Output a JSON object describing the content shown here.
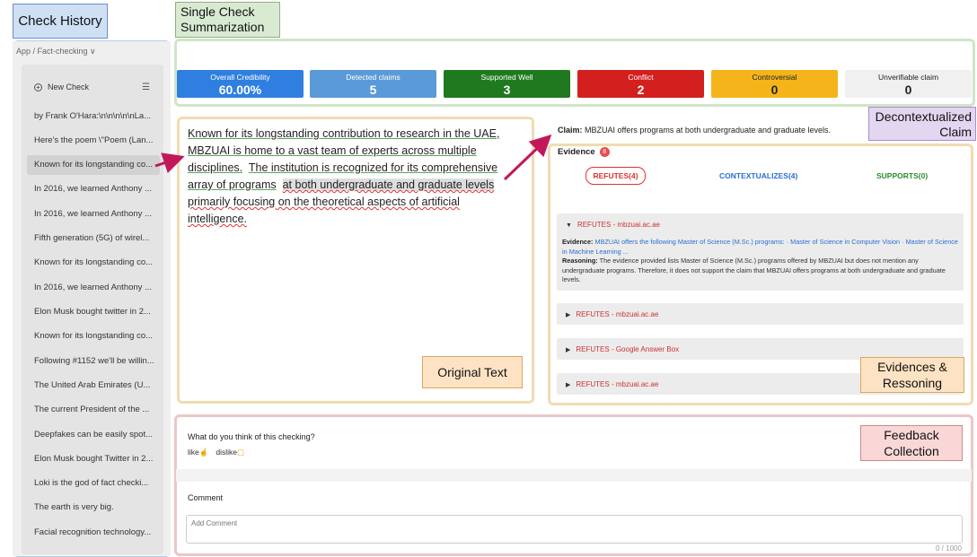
{
  "annotations": {
    "check_history": "Check History",
    "single_check": "Single Check\nSummarization",
    "decontextualized": "Decontextualized\nClaim",
    "original_text": "Original Text",
    "evidences": "Evidences &\nRessoning",
    "feedback": "Feedback\nCollection"
  },
  "breadcrumb": "App / Fact-checking ∨",
  "sidebar": {
    "new_check_label": "New Check",
    "items": [
      "by Frank O'Hara:\\n\\n\\n\\n\\nLa...",
      "Here's the poem \\\"Poem (Lan...",
      "Known for its longstanding co...",
      "In 2016, we learned Anthony ...",
      "In 2016, we learned Anthony ...",
      "Fifth generation (5G) of wirel...",
      "Known for its longstanding co...",
      "In 2016, we learned Anthony ...",
      "Elon Musk bought twitter in 2...",
      "Known for its longstanding co...",
      "Following #1152 we'll be willin...",
      "The United Arab Emirates (U...",
      "The current President of the ...",
      "Deepfakes can be easily spot...",
      "Elon Musk bought Twitter in 2...",
      "Loki is the god of fact checki...",
      "The earth is very big.",
      "Facial recognition technology..."
    ]
  },
  "stats": [
    {
      "label": "Overall Credibility",
      "value": "60.00%",
      "bg": "#2f7fe0",
      "fg": "#ffffff"
    },
    {
      "label": "Detected claims",
      "value": "5",
      "bg": "#5b9ad8",
      "fg": "#ffffff"
    },
    {
      "label": "Supported Well",
      "value": "3",
      "bg": "#1f7a1f",
      "fg": "#ffffff"
    },
    {
      "label": "Conflict",
      "value": "2",
      "bg": "#d41f1f",
      "fg": "#ffffff"
    },
    {
      "label": "Controversial",
      "value": "0",
      "bg": "#f5b51a",
      "fg": "#222222"
    },
    {
      "label": "Unverifiable claim",
      "value": "0",
      "bg": "#f0f0f0",
      "fg": "#222222"
    }
  ],
  "original_text": {
    "s1": "Known for its longstanding contribution to research in the UAE,",
    "s2": "MBZUAI is home to a vast team of experts across multiple disciplines.",
    "s3": "The institution is recognized for its comprehensive array of programs",
    "s4": "at both undergraduate and graduate levels",
    "s5": "primarily focusing on the theoretical aspects of artificial intelligence."
  },
  "claim": {
    "prefix": "Claim:",
    "text": "MBZUAI offers programs at both undergraduate and graduate levels."
  },
  "evidence": {
    "title": "Evidence",
    "count": "8",
    "tabs": {
      "refutes": "REFUTES(4)",
      "contextualizes": "CONTEXTUALIZES(4)",
      "supports": "SUPPORTS(0)"
    },
    "open_item": {
      "head": "REFUTES - mbzuai.ac.ae",
      "evidence_label": "Evidence:",
      "evidence_text": "MBZUAI offers the following Master of Science (M.Sc.) programs: · Master of Science in Computer Vision · Master of Science in Machine Learning ...",
      "reasoning_label": "Reasoning:",
      "reasoning_text": "The evidence provided lists Master of Science (M.Sc.) programs offered by MBZUAI but does not mention any undergraduate programs. Therefore, it does not support the claim that MBZUAI offers programs at both undergraduate and graduate levels."
    },
    "collapsed": [
      "REFUTES - mbzuai.ac.ae",
      "REFUTES - Google Answer Box",
      "REFUTES - mbzuai.ac.ae"
    ]
  },
  "feedback": {
    "question": "What do you think of this checking?",
    "like": "like",
    "dislike": "dislike",
    "comment_label": "Comment",
    "comment_placeholder": "Add Comment",
    "counter": "0 / 1000"
  },
  "colors": {
    "accent_arrow": "#c2185b"
  }
}
